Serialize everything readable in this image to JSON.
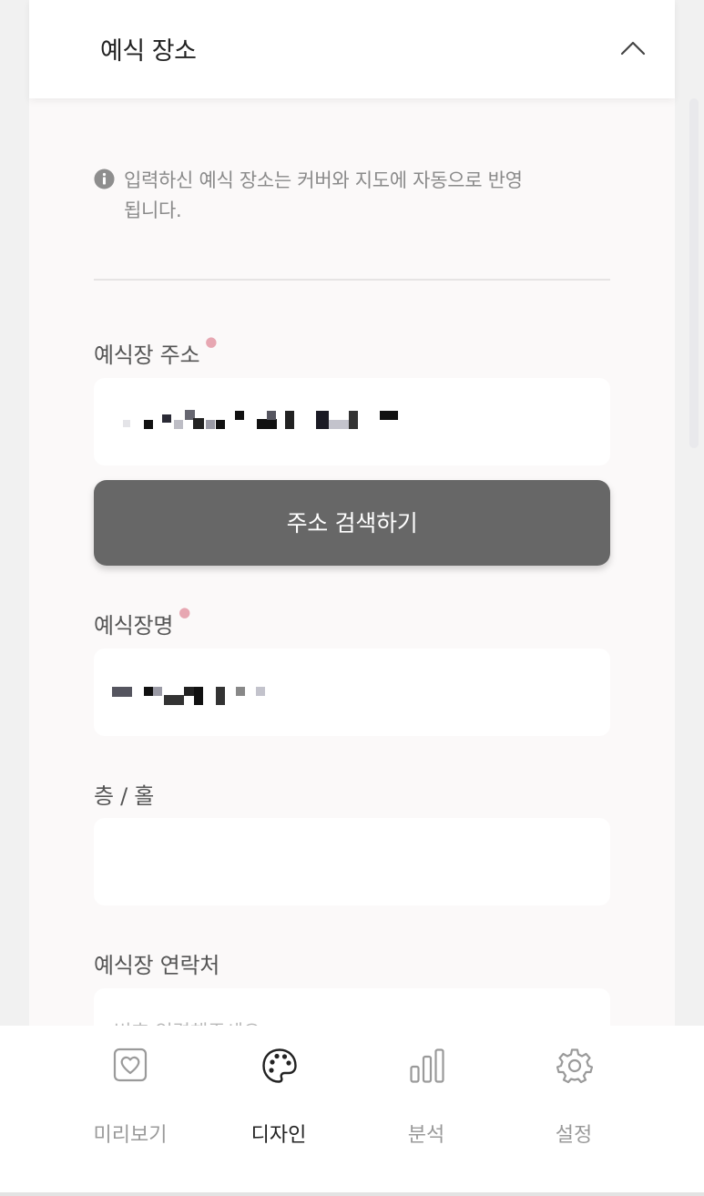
{
  "section": {
    "title": "예식 장소",
    "info_text": "입력하신 예식 장소는 커버와 지도에 자동으로 반영됩니다."
  },
  "fields": {
    "address": {
      "label": "예식장 주소",
      "required": true,
      "value": ""
    },
    "search_button_label": "주소 검색하기",
    "venue_name": {
      "label": "예식장명",
      "required": true,
      "value": ""
    },
    "floor_hall": {
      "label": "층 / 홀",
      "value": ""
    },
    "contact": {
      "label": "예식장 연락처",
      "placeholder": "번호 입력해주세요"
    }
  },
  "tabs": [
    {
      "label": "미리보기",
      "icon": "heart-frame-icon",
      "active": false
    },
    {
      "label": "디자인",
      "icon": "palette-icon",
      "active": true
    },
    {
      "label": "분석",
      "icon": "bar-chart-icon",
      "active": false
    },
    {
      "label": "설정",
      "icon": "gear-icon",
      "active": false
    }
  ],
  "colors": {
    "page_bg": "#f1f1f1",
    "card_bg": "#fbf9f9",
    "button_bg": "#676767",
    "required_mark": "#e7a7b2",
    "active_tab": "#222222",
    "inactive_tab": "#9a9a9a"
  }
}
